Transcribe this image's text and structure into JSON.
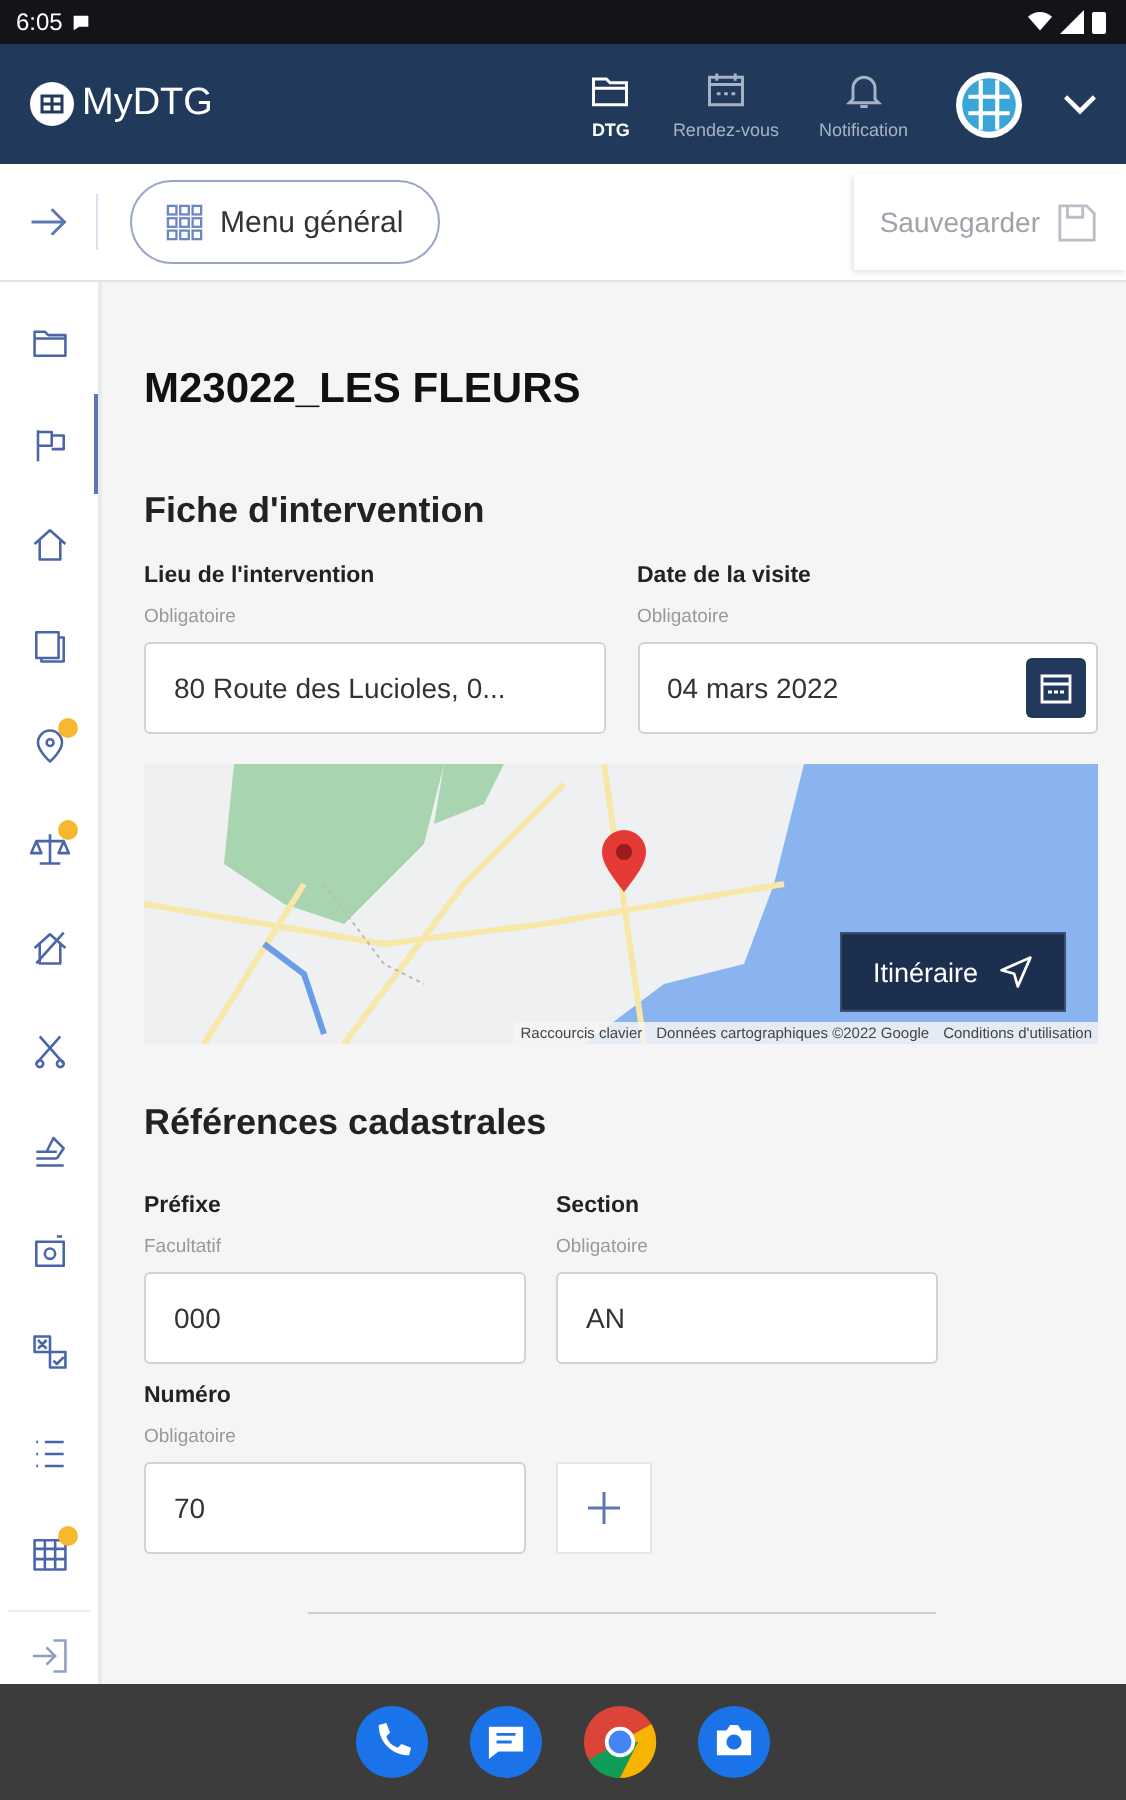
{
  "status_bar": {
    "time": "6:05"
  },
  "app_bar": {
    "logo": "MyDTG",
    "tabs": [
      {
        "label": "DTG",
        "selected": true
      },
      {
        "label": "Rendez-vous",
        "selected": false
      },
      {
        "label": "Notification",
        "selected": false
      }
    ]
  },
  "toolbar": {
    "menu_button": "Menu général",
    "save_button": "Sauvegarder"
  },
  "sidebar": {
    "items": [
      {
        "selected": false,
        "badge": false
      },
      {
        "selected": true,
        "badge": false
      },
      {
        "selected": false,
        "badge": false
      },
      {
        "selected": false,
        "badge": false
      },
      {
        "selected": false,
        "badge": true
      },
      {
        "selected": false,
        "badge": true
      },
      {
        "selected": false,
        "badge": false
      },
      {
        "selected": false,
        "badge": false
      },
      {
        "selected": false,
        "badge": false
      },
      {
        "selected": false,
        "badge": false
      },
      {
        "selected": false,
        "badge": false
      },
      {
        "selected": false,
        "badge": false
      },
      {
        "selected": false,
        "badge": true
      }
    ]
  },
  "title": "M23022_LES FLEURS",
  "intervention": {
    "heading": "Fiche d'intervention",
    "place": {
      "label": "Lieu de l'intervention",
      "hint": "Obligatoire",
      "value": "80 Route des Lucioles, 0..."
    },
    "date": {
      "label": "Date de la visite",
      "hint": "Obligatoire",
      "value": "04 mars 2022"
    },
    "map": {
      "button": "Itinéraire",
      "attribution": [
        "Raccourcis clavier",
        "Données cartographiques ©2022 Google",
        "Conditions d'utilisation"
      ]
    }
  },
  "cadastre": {
    "heading": "Références cadastrales",
    "fields": [
      {
        "label": "Préfixe",
        "hint": "Facultatif",
        "value": "000"
      },
      {
        "label": "Section",
        "hint": "Obligatoire",
        "value": "AN"
      },
      {
        "label": "Numéro",
        "hint": "Obligatoire",
        "value": "70"
      }
    ]
  }
}
